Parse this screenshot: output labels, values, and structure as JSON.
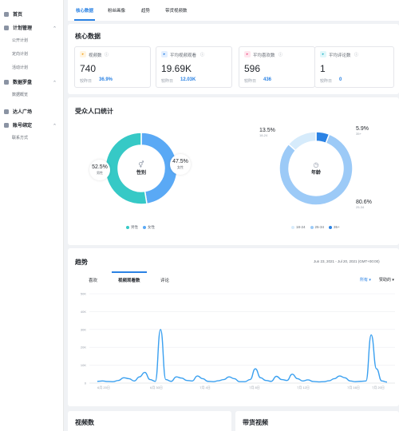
{
  "sidebar": {
    "items": [
      {
        "type": "group",
        "label": "首页",
        "icon": "home-icon",
        "expandable": false
      },
      {
        "type": "group",
        "label": "计划管理",
        "icon": "plan-icon",
        "expandable": true
      },
      {
        "type": "sub",
        "label": "公开计划"
      },
      {
        "type": "sub",
        "label": "定向计划"
      },
      {
        "type": "sub",
        "label": "活动计划"
      },
      {
        "type": "group",
        "label": "数据罗盘",
        "icon": "compass-icon",
        "expandable": true
      },
      {
        "type": "sub",
        "label": "数据概览"
      },
      {
        "type": "gap"
      },
      {
        "type": "group",
        "label": "达人广场",
        "icon": "user-square-icon",
        "expandable": false
      },
      {
        "type": "group",
        "label": "账号绑定",
        "icon": "account-icon",
        "expandable": true
      },
      {
        "type": "sub",
        "label": "联系方式"
      }
    ]
  },
  "tabs": [
    "核心数据",
    "粉丝画像",
    "趋势",
    "带货视频数"
  ],
  "core": {
    "title": "核心数据",
    "compare_label": "较昨日",
    "metrics": [
      {
        "label": "视频数",
        "value": "740",
        "change": "36.9%",
        "icon": "play-icon",
        "color": "#f5a623",
        "bg": "#fff4e0"
      },
      {
        "label": "平均视频观看",
        "value": "19.69K",
        "change": "12.03K",
        "icon": "eye-icon",
        "color": "#2a82e4",
        "bg": "#e3efff"
      },
      {
        "label": "平均喜欢数",
        "value": "596",
        "change": "436",
        "icon": "heart-icon",
        "color": "#f0588a",
        "bg": "#ffe6ee"
      },
      {
        "label": "平均评论数",
        "value": "1",
        "change": "0",
        "icon": "comment-icon",
        "color": "#2ab7c9",
        "bg": "#e0f7fa"
      }
    ]
  },
  "audience": {
    "title": "受众人口统计",
    "gender": {
      "center": "性别",
      "slices": [
        {
          "label": "女性",
          "pct": "47.5%",
          "value": 47.5,
          "color": "#5aa9f5"
        },
        {
          "label": "男性",
          "pct": "52.5%",
          "value": 52.5,
          "color": "#36c9c6"
        }
      ],
      "legend": [
        "男性",
        "女性"
      ]
    },
    "age": {
      "center": "年龄",
      "slices": [
        {
          "label": "35+",
          "pct": "5.9%",
          "value": 5.9,
          "color": "#2a82e4"
        },
        {
          "label": "25-34",
          "pct": "80.6%",
          "value": 80.6,
          "color": "#9ccaf7"
        },
        {
          "label": "18-24",
          "pct": "13.5%",
          "value": 13.5,
          "color": "#d6ebfb"
        }
      ],
      "legend": [
        "18-24",
        "25-34",
        "35+"
      ]
    }
  },
  "trend": {
    "title": "趋势",
    "date_range": "Jun 23, 2021 - Jul 20, 2021 (GMT+00:00)",
    "tabs": [
      "喜欢",
      "视频观看数",
      "评论"
    ],
    "filter_all": "所有",
    "filter_sponsored": "赞助的",
    "y_ticks": [
      "50K",
      "40K",
      "30K",
      "20K",
      "10K",
      "0"
    ],
    "x_ticks": [
      "6月 20日",
      "6月 30日",
      "7月 4日",
      "7月 8日",
      "7月 12日",
      "7月 16日",
      "7月 20日"
    ]
  },
  "bottom": {
    "left_title": "视频数",
    "right_title": "带货视频"
  },
  "chart_data": {
    "type": "line",
    "ylim": [
      0,
      50000
    ],
    "series": [
      {
        "values": [
          1000,
          1200,
          900,
          800,
          1500,
          3000,
          2500,
          1200,
          3500,
          6000,
          2000,
          1000,
          30000,
          2000,
          1000,
          3500,
          2800,
          1500,
          1200,
          4000,
          2500,
          1000,
          800,
          1300,
          2000,
          3500,
          2500,
          800,
          800,
          2000,
          8000,
          3000,
          1500,
          1000,
          3800,
          2000,
          1500,
          5000,
          2500,
          1200,
          1800,
          900,
          700,
          800,
          1300,
          2500,
          4000,
          3000,
          1200,
          800,
          1000,
          1200,
          27000,
          8000,
          1200,
          600
        ]
      }
    ]
  }
}
